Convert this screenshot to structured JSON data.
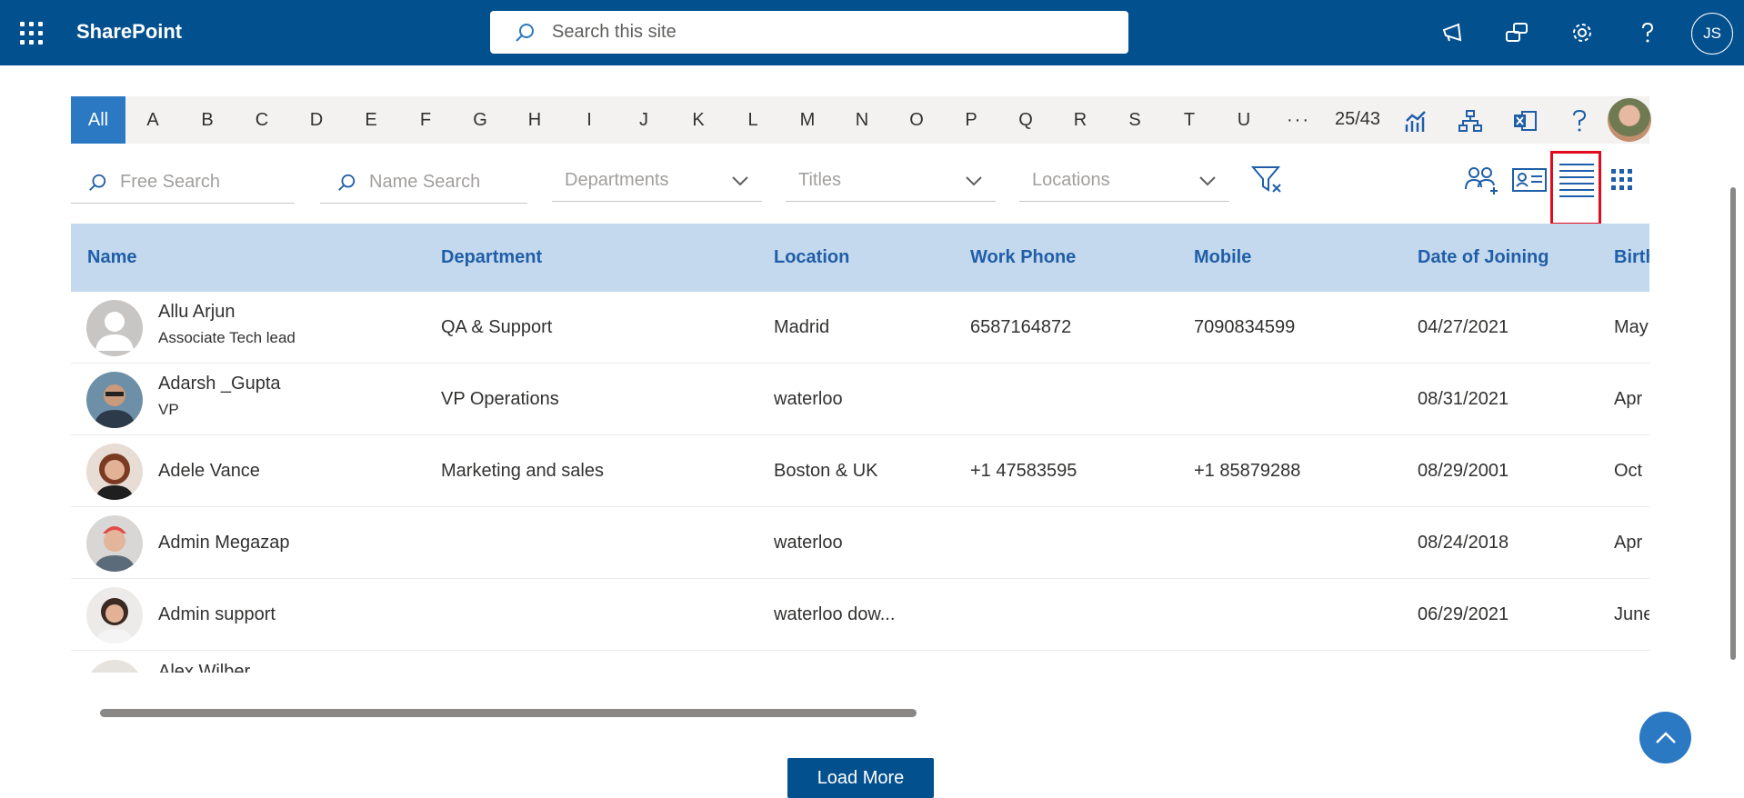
{
  "header": {
    "app_name": "SharePoint",
    "search_placeholder": "Search this site",
    "user_initials": "JS"
  },
  "alphabet": {
    "letters": [
      "All",
      "A",
      "B",
      "C",
      "D",
      "E",
      "F",
      "G",
      "H",
      "I",
      "J",
      "K",
      "L",
      "M",
      "N",
      "O",
      "P",
      "Q",
      "R",
      "S",
      "T",
      "U"
    ],
    "more": "···",
    "active": "All",
    "page_count": "25/43"
  },
  "filters": {
    "free_search_placeholder": "Free Search",
    "name_search_placeholder": "Name Search",
    "departments_placeholder": "Departments",
    "titles_placeholder": "Titles",
    "locations_placeholder": "Locations"
  },
  "table": {
    "columns": [
      "Name",
      "Department",
      "Location",
      "Work Phone",
      "Mobile",
      "Date of Joining",
      "Birth"
    ],
    "rows": [
      {
        "name": "Allu Arjun",
        "title": "Associate Tech lead",
        "department": "QA & Support",
        "location": "Madrid",
        "work_phone": "6587164872",
        "mobile": "7090834599",
        "doj": "04/27/2021",
        "birthday": "May"
      },
      {
        "name": "Adarsh _Gupta",
        "title": "VP",
        "department": "VP Operations",
        "location": "waterloo",
        "work_phone": "",
        "mobile": "",
        "doj": "08/31/2021",
        "birthday": "Apr"
      },
      {
        "name": "Adele Vance",
        "title": "",
        "department": "Marketing and sales",
        "location": "Boston & UK",
        "work_phone": "+1 47583595",
        "mobile": "+1 85879288",
        "doj": "08/29/2001",
        "birthday": "Oct"
      },
      {
        "name": "Admin Megazap",
        "title": "",
        "department": "",
        "location": "waterloo",
        "work_phone": "",
        "mobile": "",
        "doj": "08/24/2018",
        "birthday": "Apr"
      },
      {
        "name": "Admin support",
        "title": "",
        "department": "",
        "location": "waterloo dow...",
        "work_phone": "",
        "mobile": "",
        "doj": "06/29/2021",
        "birthday": "June"
      },
      {
        "name": "Alex Wilber",
        "title": "",
        "department": "",
        "location": "",
        "work_phone": "",
        "mobile": "",
        "doj": "",
        "birthday": ""
      }
    ]
  },
  "actions": {
    "load_more": "Load More"
  },
  "colors": {
    "suite_bar": "#03508f",
    "accent": "#2b79c2",
    "header_row": "#c5d9ee",
    "highlight": "#e00b1c"
  }
}
